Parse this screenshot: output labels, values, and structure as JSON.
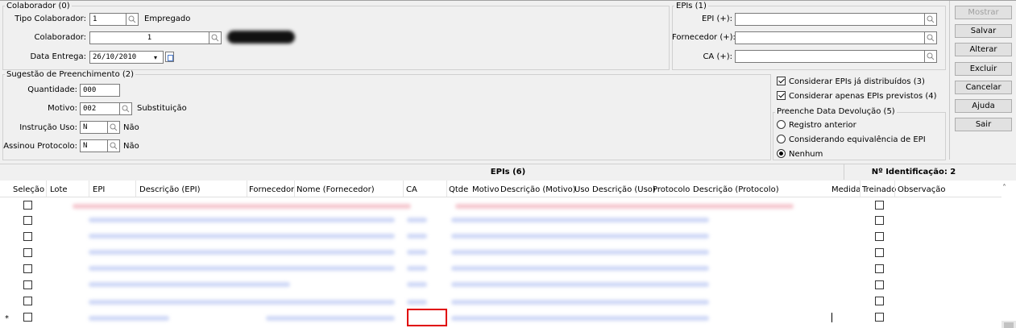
{
  "colaborador_group": {
    "title": "Colaborador (0)",
    "tipo_label": "Tipo Colaborador:",
    "tipo_value": "1",
    "tipo_desc": "Empregado",
    "colaborador_label": "Colaborador:",
    "colaborador_value": "1",
    "data_label": "Data Entrega:",
    "data_value": "26/10/2010"
  },
  "epis_group": {
    "title": "EPIs (1)",
    "epi_label": "EPI (+):",
    "fornecedor_label": "Fornecedor (+):",
    "ca_label": "CA (+):"
  },
  "sugestao_group": {
    "title": "Sugestão de Preenchimento (2)",
    "quantidade_label": "Quantidade:",
    "quantidade_value": "000",
    "motivo_label": "Motivo:",
    "motivo_value": "002",
    "motivo_desc": "Substituição",
    "instrucao_label": "Instrução Uso:",
    "instrucao_value": "N",
    "instrucao_desc": "Não",
    "protocolo_label": "Assinou Protocolo:",
    "protocolo_value": "N",
    "protocolo_desc": "Não"
  },
  "options": {
    "check1_label": "Considerar EPIs já distribuídos (3)",
    "check2_label": "Considerar apenas EPIs previstos (4)",
    "devolucao_title": "Preenche Data Devolução (5)",
    "radio1_label": "Registro anterior",
    "radio2_label": "Considerando equivalência de EPI",
    "radio3_label": "Nenhum"
  },
  "buttons": [
    "Mostrar",
    "Salvar",
    "Alterar",
    "Excluir",
    "Cancelar",
    "Ajuda",
    "Sair"
  ],
  "grid": {
    "title": "EPIs (6)",
    "id_label": "Nº Identificação: 2",
    "columns": [
      "Seleção",
      "Lote",
      "EPI",
      "Descrição (EPI)",
      "Fornecedor",
      "Nome (Fornecedor)",
      "CA",
      "Qtde",
      "Motivo",
      "Descrição (Motivo)",
      "Uso",
      "Descrição (Uso)",
      "Protocolo",
      "Descrição (Protocolo)",
      "Medida",
      "Treinado",
      "Observação"
    ],
    "new_row_marker": "*"
  }
}
